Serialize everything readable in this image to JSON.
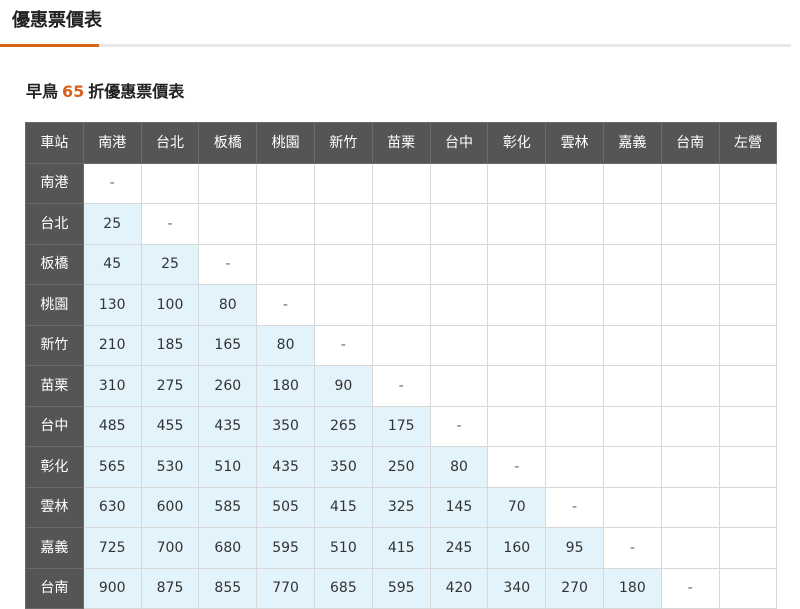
{
  "page": {
    "title": "優惠票價表",
    "section": {
      "prefix": "早鳥",
      "discount": "65",
      "suffix": "折優惠票價表"
    }
  },
  "table": {
    "corner_label": "車站",
    "columns": [
      "南港",
      "台北",
      "板橋",
      "桃園",
      "新竹",
      "苗栗",
      "台中",
      "彰化",
      "雲林",
      "嘉義",
      "台南",
      "左營"
    ],
    "rows": [
      {
        "station": "南港",
        "fares": [
          "-"
        ]
      },
      {
        "station": "台北",
        "fares": [
          "25",
          "-"
        ]
      },
      {
        "station": "板橋",
        "fares": [
          "45",
          "25",
          "-"
        ]
      },
      {
        "station": "桃園",
        "fares": [
          "130",
          "100",
          "80",
          "-"
        ]
      },
      {
        "station": "新竹",
        "fares": [
          "210",
          "185",
          "165",
          "80",
          "-"
        ]
      },
      {
        "station": "苗栗",
        "fares": [
          "310",
          "275",
          "260",
          "180",
          "90",
          "-"
        ]
      },
      {
        "station": "台中",
        "fares": [
          "485",
          "455",
          "435",
          "350",
          "265",
          "175",
          "-"
        ]
      },
      {
        "station": "彰化",
        "fares": [
          "565",
          "530",
          "510",
          "435",
          "350",
          "250",
          "80",
          "-"
        ]
      },
      {
        "station": "雲林",
        "fares": [
          "630",
          "600",
          "585",
          "505",
          "415",
          "325",
          "145",
          "70",
          "-"
        ]
      },
      {
        "station": "嘉義",
        "fares": [
          "725",
          "700",
          "680",
          "595",
          "510",
          "415",
          "245",
          "160",
          "95",
          "-"
        ]
      },
      {
        "station": "台南",
        "fares": [
          "900",
          "875",
          "855",
          "770",
          "685",
          "595",
          "420",
          "340",
          "270",
          "180",
          "-"
        ]
      }
    ]
  },
  "colors": {
    "accent": "#d9621f",
    "header_bg": "#555555",
    "highlight_bg": "#e3f3fb"
  }
}
